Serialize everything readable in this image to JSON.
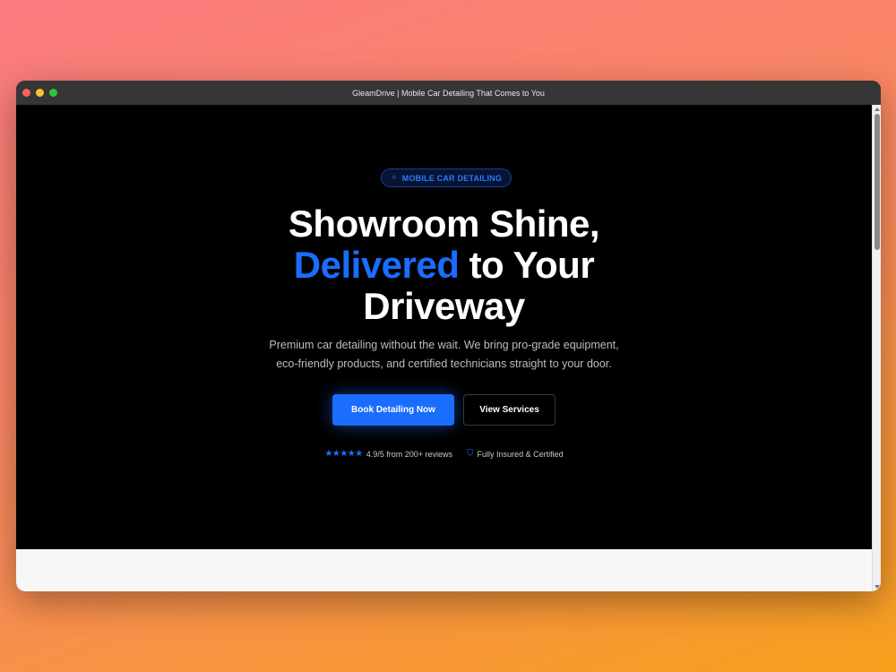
{
  "window": {
    "title": "GleamDrive | Mobile Car Detailing That Comes to You"
  },
  "hero": {
    "badge_icon": "sparkles-icon",
    "badge_glyph": "✧",
    "badge_text": "MOBILE CAR DETAILING",
    "headline_line1": "Showroom Shine,",
    "headline_accent": "Delivered",
    "headline_line2_rest": " to Your",
    "headline_line3": "Driveway",
    "subtext_line1": "Premium car detailing without the wait. We bring pro-grade equipment,",
    "subtext_line2": "eco-friendly products, and certified technicians straight to your door.",
    "primary_cta": "Book Detailing Now",
    "secondary_cta": "View Services",
    "stars_glyph": "★★★★★",
    "rating_stars": 5,
    "rating_text": "4.9/5 from 200+ reviews",
    "shield_glyph": "⛉",
    "insured_text": "Fully Insured & Certified"
  },
  "colors": {
    "accent": "#1a6dff",
    "hero_background": "#000000",
    "below_fold_background": "#f7f7f7"
  }
}
